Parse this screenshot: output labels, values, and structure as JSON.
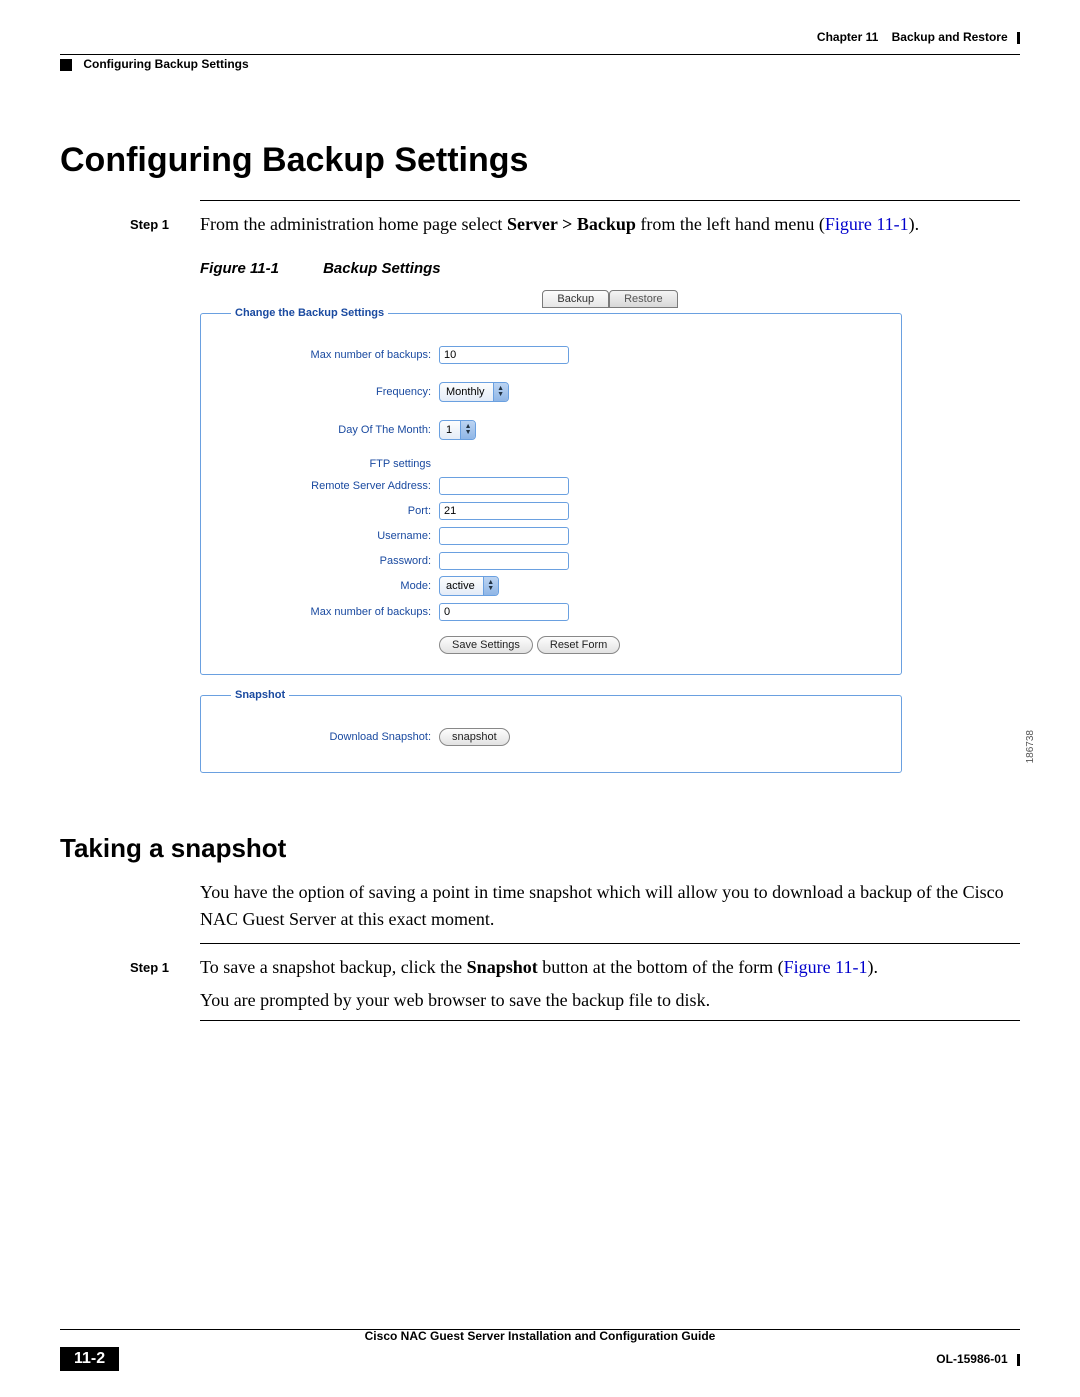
{
  "header": {
    "chapter_label": "Chapter 11",
    "chapter_title": "Backup and Restore",
    "section_label": "Configuring Backup Settings"
  },
  "h1": "Configuring Backup Settings",
  "step1": {
    "label": "Step 1",
    "pre": "From the administration home page select ",
    "bold": "Server > Backup",
    "mid": " from the left hand menu (",
    "figref": "Figure 11-1",
    "post": ")."
  },
  "figure": {
    "num": "Figure 11-1",
    "title": "Backup Settings",
    "tabs": {
      "backup": "Backup",
      "restore": "Restore"
    },
    "legend1": "Change the Backup Settings",
    "legend2": "Snapshot",
    "labels": {
      "max_backups": "Max number of backups:",
      "frequency": "Frequency:",
      "day_of_month": "Day Of The Month:",
      "ftp_settings": "FTP settings",
      "remote_addr": "Remote Server Address:",
      "port": "Port:",
      "username": "Username:",
      "password": "Password:",
      "mode": "Mode:",
      "max_backups2": "Max number of backups:",
      "download_snapshot": "Download Snapshot:"
    },
    "values": {
      "max_backups": "10",
      "frequency": "Monthly",
      "day_of_month": "1",
      "remote_addr": "",
      "port": "21",
      "username": "",
      "password": "",
      "mode": "active",
      "max_backups2": "0"
    },
    "buttons": {
      "save": "Save Settings",
      "reset": "Reset Form",
      "snapshot": "snapshot"
    },
    "image_id": "186738"
  },
  "h2": "Taking a snapshot",
  "snapshot_para": "You have the option of saving a point in time snapshot which will allow you to download a backup of the Cisco NAC Guest Server at this exact moment.",
  "snapshot_step": {
    "label": "Step 1",
    "pre": "To save a snapshot backup, click the ",
    "bold": "Snapshot",
    "mid": " button at the bottom of the form (",
    "figref": "Figure 11-1",
    "post": ")."
  },
  "snapshot_after": "You are prompted by your web browser to save the backup file to disk.",
  "footer": {
    "doc_title": "Cisco NAC Guest Server Installation and Configuration Guide",
    "page_num": "11-2",
    "doc_id": "OL-15986-01"
  }
}
